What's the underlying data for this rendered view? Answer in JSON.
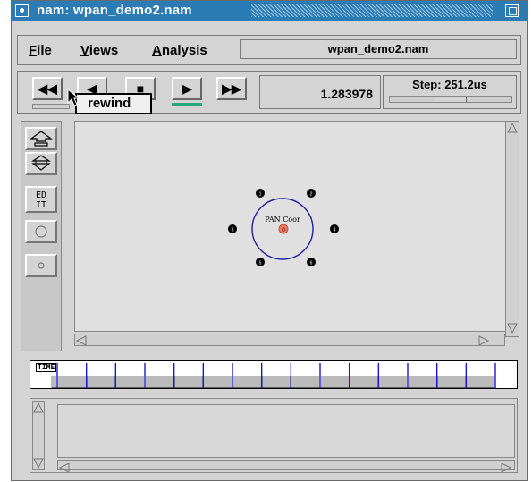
{
  "window": {
    "title": "nam: wpan_demo2.nam"
  },
  "menubar": {
    "file": {
      "first": "F",
      "rest": "ile"
    },
    "views": {
      "first": "V",
      "rest": "iews"
    },
    "analysis": {
      "first": "A",
      "rest": "nalysis"
    },
    "filename": "wpan_demo2.nam"
  },
  "playback": {
    "rewind_label": "◀◀",
    "back_label": "◀",
    "stop_label": "■",
    "play_label": "▶",
    "fastforward_label": "▶▶",
    "time": "1.283978",
    "step": "Step: 251.2us"
  },
  "tooltip": {
    "text": "rewind"
  },
  "toolbar": {
    "edit_label_line1": "ED",
    "edit_label_line2": "IT"
  },
  "network": {
    "coordinator_label": "PAN Coor",
    "coordinator_id": "0",
    "nodes": [
      "1",
      "2",
      "3",
      "4",
      "5",
      "6"
    ]
  },
  "timeline": {
    "label": "TIME",
    "marker_count": 16
  },
  "colors": {
    "titlebar": "#2b7bb5",
    "play_indicator": "#2aa87d",
    "coordinator_fill": "#f07860",
    "range_circle": "#2020a0",
    "timeline_marker": "#1a1acc"
  }
}
